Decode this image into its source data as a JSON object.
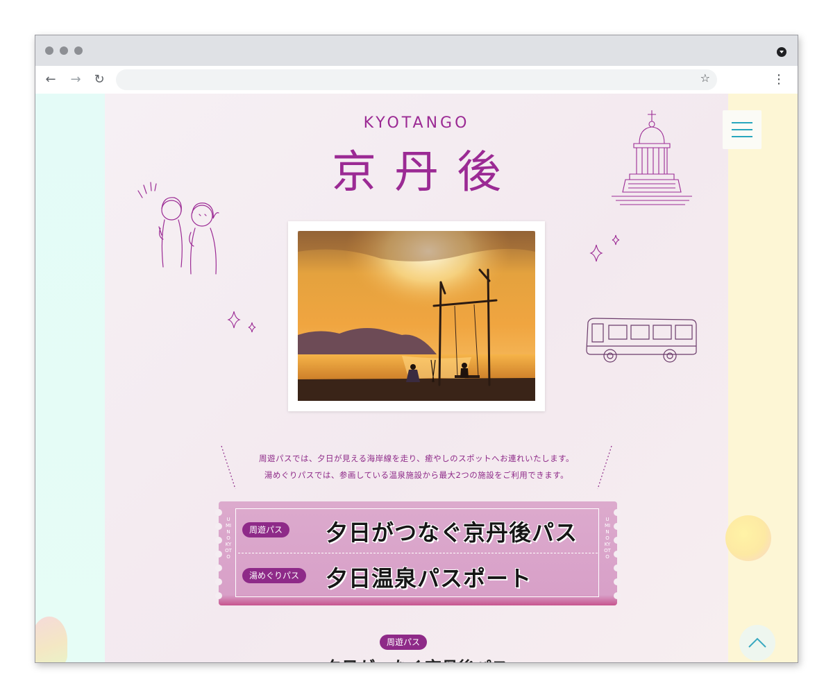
{
  "browser": {
    "url": "",
    "icons": {
      "back": "back-arrow-icon",
      "forward": "forward-arrow-icon",
      "reload": "reload-icon",
      "bookmark": "star-icon",
      "menu": "kebab-menu-icon"
    }
  },
  "header": {
    "brand_en": "KYOTANGO",
    "brand_jp": "京丹後"
  },
  "intro": {
    "line1": "周遊パスでは、夕日が見える海岸線を走り、癒やしのスポットへお連れいたします。",
    "line2": "湯めぐりパスでは、参画している温泉施設から最大2つの施設をご利用できます。"
  },
  "ticket": {
    "pass1_badge": "周遊パス",
    "pass1_title": "夕日がつなぐ京丹後パス",
    "pass2_badge": "湯めぐりパス",
    "pass2_title": "夕日温泉パスポート",
    "side_text": "UMI NO KYOTO"
  },
  "section": {
    "badge": "周遊パス",
    "title": "夕日がつなぐ京丹後パス"
  },
  "colors": {
    "brand": "#9b2a94",
    "ticket": "#d8a5c9",
    "menu_accent": "#27a6bd"
  }
}
